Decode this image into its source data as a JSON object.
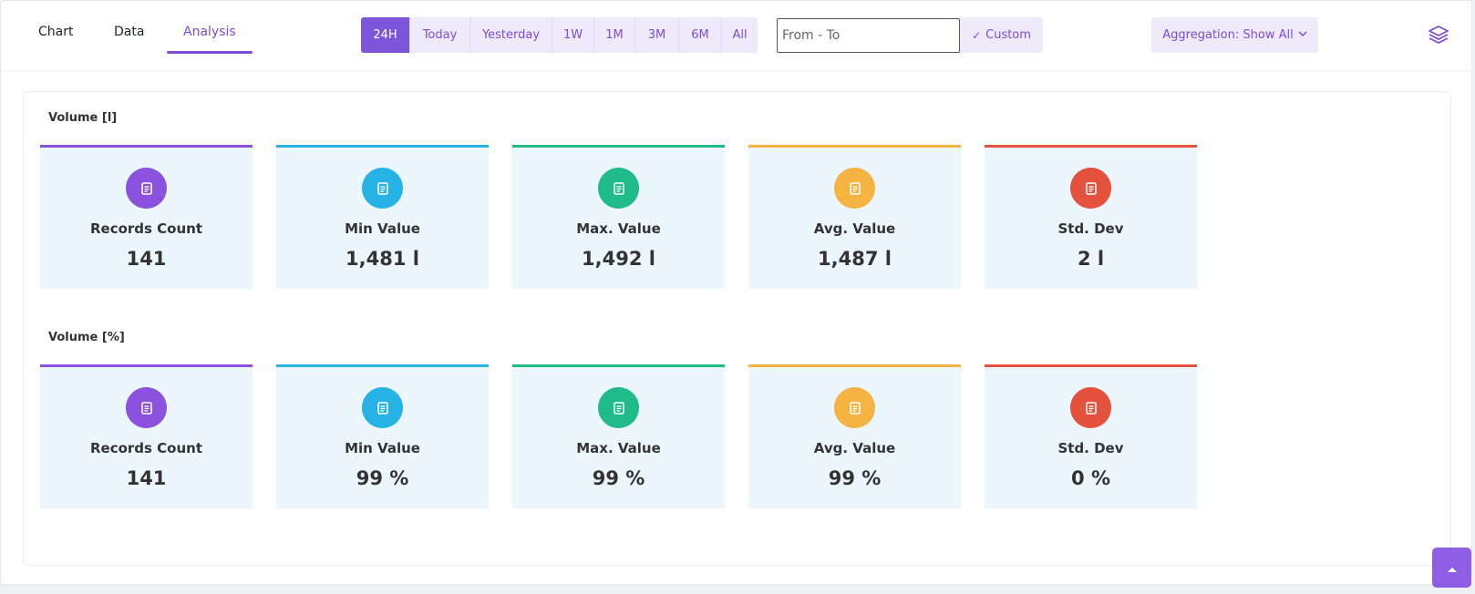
{
  "tabs": [
    {
      "label": "Chart"
    },
    {
      "label": "Data"
    },
    {
      "label": "Analysis"
    }
  ],
  "active_tab": "Analysis",
  "range_buttons": [
    "24H",
    "Today",
    "Yesterday",
    "1W",
    "1M",
    "3M",
    "6M",
    "All"
  ],
  "active_range": "24H",
  "date_range": {
    "placeholder": "From - To",
    "value": ""
  },
  "custom_label": "Custom",
  "aggregation_label": "Aggregation: Show All",
  "colors": {
    "accent": "#7c55db",
    "records": "#8a52df",
    "min": "#27b2e6",
    "max": "#1fbb88",
    "avg": "#f5b342",
    "std": "#e4513c",
    "card_bg": "#ecf6fd"
  },
  "sections": [
    {
      "title": "Volume [l]",
      "cards": [
        {
          "label": "Records Count",
          "value": "141",
          "icon": "document-icon",
          "color": "#8a52df"
        },
        {
          "label": "Min Value",
          "value": "1,481 l",
          "icon": "document-icon",
          "color": "#27b2e6"
        },
        {
          "label": "Max. Value",
          "value": "1,492 l",
          "icon": "document-icon",
          "color": "#1fbb88"
        },
        {
          "label": "Avg. Value",
          "value": "1,487 l",
          "icon": "document-icon",
          "color": "#f5b342"
        },
        {
          "label": "Std. Dev",
          "value": "2 l",
          "icon": "document-icon",
          "color": "#e4513c"
        }
      ]
    },
    {
      "title": "Volume [%]",
      "cards": [
        {
          "label": "Records Count",
          "value": "141",
          "icon": "document-icon",
          "color": "#8a52df"
        },
        {
          "label": "Min Value",
          "value": "99 %",
          "icon": "document-icon",
          "color": "#27b2e6"
        },
        {
          "label": "Max. Value",
          "value": "99 %",
          "icon": "document-icon",
          "color": "#1fbb88"
        },
        {
          "label": "Avg. Value",
          "value": "99 %",
          "icon": "document-icon",
          "color": "#f5b342"
        },
        {
          "label": "Std. Dev",
          "value": "0 %",
          "icon": "document-icon",
          "color": "#e4513c"
        }
      ]
    }
  ]
}
